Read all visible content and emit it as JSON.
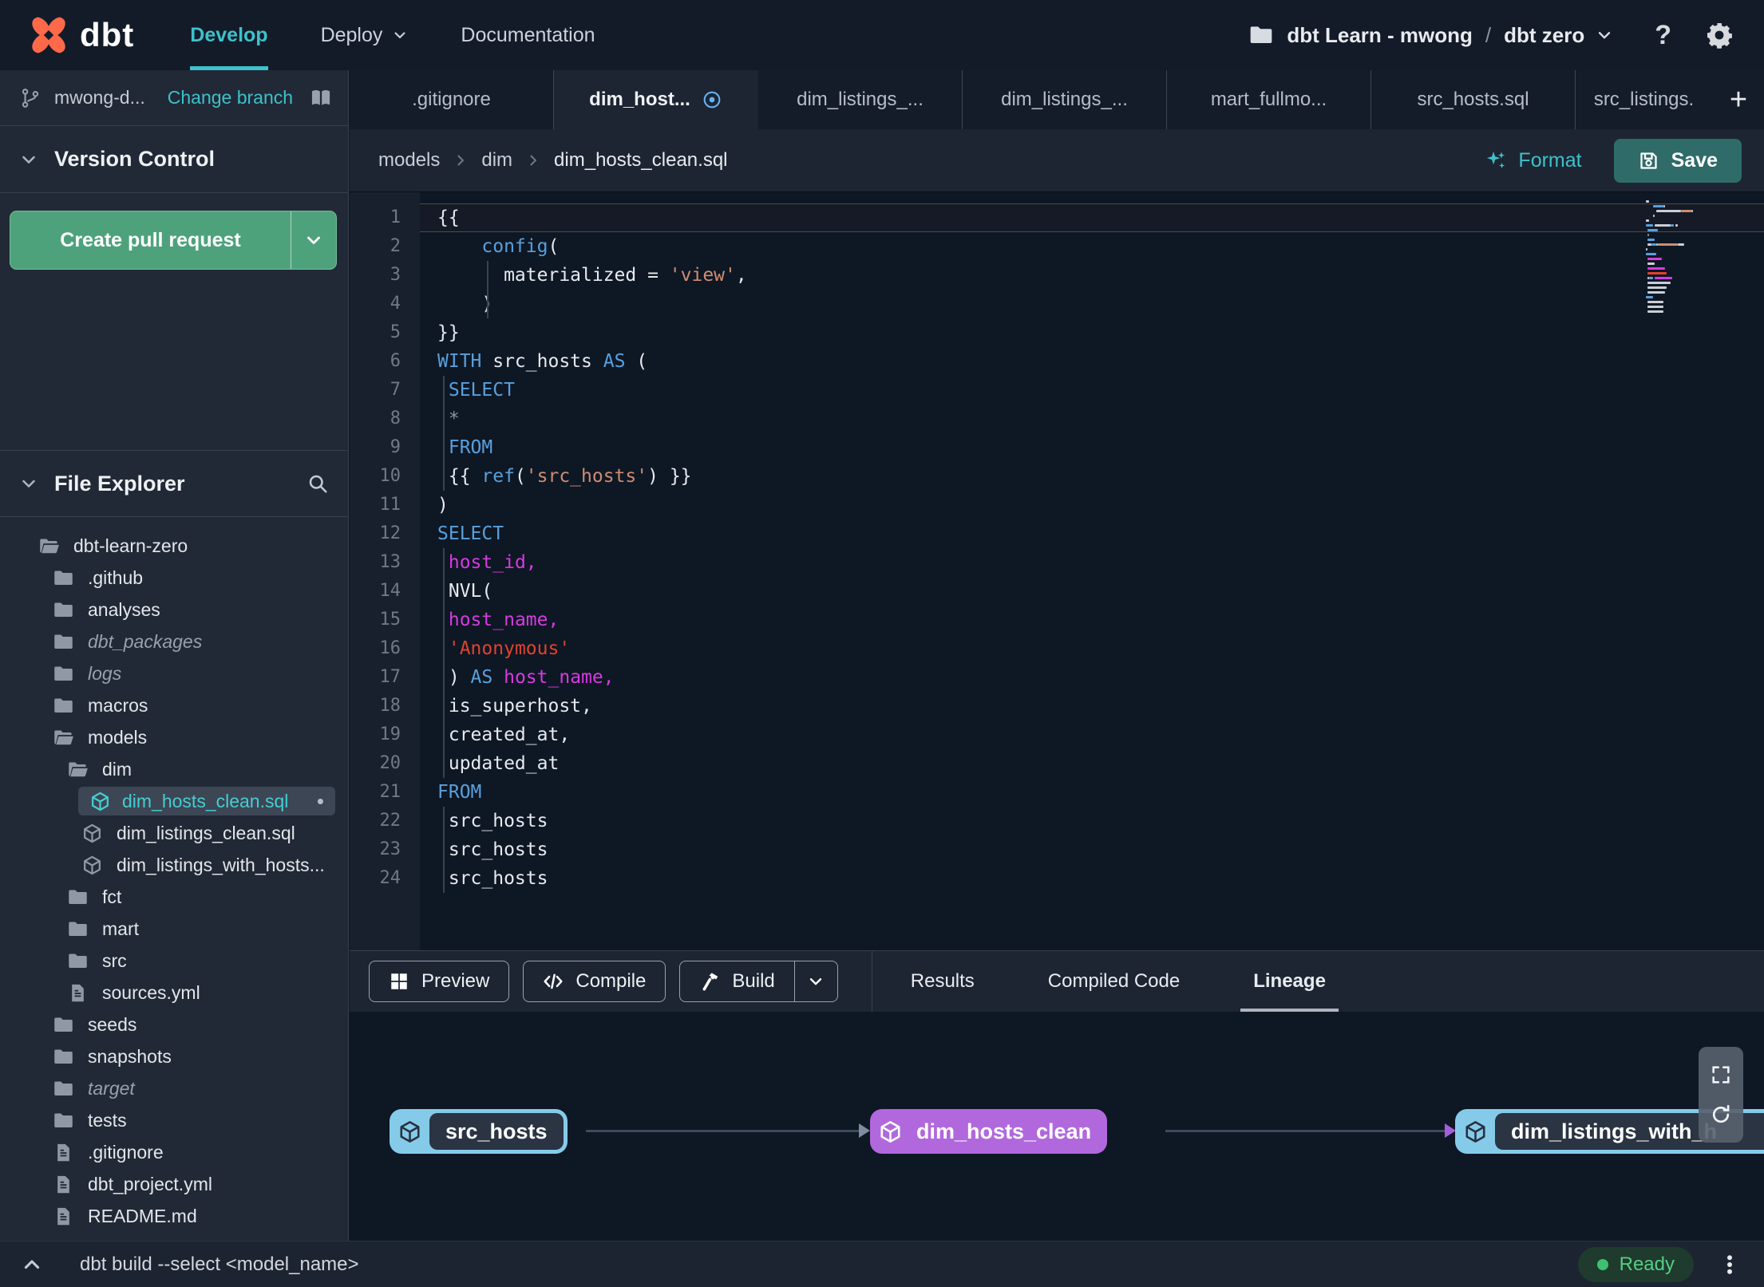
{
  "colors": {
    "accent_teal": "#3ec1ca",
    "green_button": "#4ea27b",
    "save_button_teal": "#2f6b68",
    "lineage_node_blue": "#85cbe9",
    "lineage_node_purple": "#b168dd",
    "ready_green": "#57cc86",
    "tab_modified_blue": "#66b3f5",
    "code_keyword_blue": "#58a0dc",
    "code_identifier_magenta": "#d63ae1",
    "code_string_salmon": "#cf8d72",
    "code_string_red": "#e0432d"
  },
  "topbar": {
    "brand": "dbt",
    "nav": [
      {
        "label": "Develop",
        "active": true
      },
      {
        "label": "Deploy",
        "caret": true
      },
      {
        "label": "Documentation"
      }
    ],
    "project": {
      "account": "dbt Learn - mwong",
      "separator": "/",
      "name": "dbt zero"
    }
  },
  "sidebar": {
    "branch": {
      "name": "mwong-d...",
      "action": "Change branch"
    },
    "version_control": {
      "title": "Version Control",
      "create_pr_label": "Create pull request"
    },
    "file_explorer": {
      "title": "File Explorer"
    },
    "tree": [
      {
        "label": "dbt-learn-zero",
        "type": "folder-open",
        "depth": 0
      },
      {
        "label": ".github",
        "type": "folder",
        "depth": 1
      },
      {
        "label": "analyses",
        "type": "folder",
        "depth": 1
      },
      {
        "label": "dbt_packages",
        "type": "folder",
        "depth": 1,
        "italic": true
      },
      {
        "label": "logs",
        "type": "folder",
        "depth": 1,
        "italic": true
      },
      {
        "label": "macros",
        "type": "folder",
        "depth": 1
      },
      {
        "label": "models",
        "type": "folder-open",
        "depth": 1
      },
      {
        "label": "dim",
        "type": "folder-open",
        "depth": 2
      },
      {
        "label": "dim_hosts_clean.sql",
        "type": "model",
        "depth": 3,
        "selected": true,
        "modified": true
      },
      {
        "label": "dim_listings_clean.sql",
        "type": "model",
        "depth": 3
      },
      {
        "label": "dim_listings_with_hosts...",
        "type": "model",
        "depth": 3
      },
      {
        "label": "fct",
        "type": "folder",
        "depth": 2
      },
      {
        "label": "mart",
        "type": "folder",
        "depth": 2
      },
      {
        "label": "src",
        "type": "folder",
        "depth": 2
      },
      {
        "label": "sources.yml",
        "type": "file",
        "depth": 2
      },
      {
        "label": "seeds",
        "type": "folder",
        "depth": 1
      },
      {
        "label": "snapshots",
        "type": "folder",
        "depth": 1
      },
      {
        "label": "target",
        "type": "folder",
        "depth": 1,
        "italic": true
      },
      {
        "label": "tests",
        "type": "folder",
        "depth": 1
      },
      {
        "label": ".gitignore",
        "type": "file",
        "depth": 1
      },
      {
        "label": "dbt_project.yml",
        "type": "file",
        "depth": 1
      },
      {
        "label": "README.md",
        "type": "file",
        "depth": 1
      }
    ]
  },
  "tabs": [
    {
      "label": ".gitignore"
    },
    {
      "label": "dim_host...",
      "active": true,
      "modified": true
    },
    {
      "label": "dim_listings_..."
    },
    {
      "label": "dim_listings_..."
    },
    {
      "label": "mart_fullmo..."
    },
    {
      "label": "src_hosts.sql"
    },
    {
      "label": "src_listings.",
      "clipped": true
    }
  ],
  "breadcrumb": [
    "models",
    "dim",
    "dim_hosts_clean.sql"
  ],
  "editor_actions": {
    "format": "Format",
    "save": "Save"
  },
  "editor": {
    "current_line": 1,
    "lines": [
      {
        "n": 1,
        "tokens": [
          [
            "d",
            "{{"
          ]
        ]
      },
      {
        "n": 2,
        "tokens": [
          [
            "d",
            "    "
          ],
          [
            "k",
            "config"
          ],
          [
            "d",
            "("
          ]
        ]
      },
      {
        "n": 3,
        "tokens": [
          [
            "d",
            "      materialized = "
          ],
          [
            "s",
            "'view'"
          ],
          [
            "d",
            ","
          ]
        ]
      },
      {
        "n": 4,
        "tokens": [
          [
            "d",
            "    )"
          ]
        ]
      },
      {
        "n": 5,
        "tokens": [
          [
            "d",
            "}}"
          ]
        ]
      },
      {
        "n": 6,
        "tokens": [
          [
            "k",
            "WITH"
          ],
          [
            "d",
            " src_hosts "
          ],
          [
            "k",
            "AS"
          ],
          [
            "d",
            " ("
          ]
        ]
      },
      {
        "n": 7,
        "tokens": [
          [
            "d",
            " "
          ],
          [
            "k",
            "SELECT"
          ]
        ]
      },
      {
        "n": 8,
        "tokens": [
          [
            "d",
            " "
          ],
          [
            "g",
            "*"
          ]
        ]
      },
      {
        "n": 9,
        "tokens": [
          [
            "d",
            " "
          ],
          [
            "k",
            "FROM"
          ]
        ]
      },
      {
        "n": 10,
        "tokens": [
          [
            "d",
            " {{ "
          ],
          [
            "k",
            "ref"
          ],
          [
            "d",
            "("
          ],
          [
            "s",
            "'src_hosts'"
          ],
          [
            "d",
            ") }}"
          ]
        ]
      },
      {
        "n": 11,
        "tokens": [
          [
            "d",
            ")"
          ]
        ]
      },
      {
        "n": 12,
        "tokens": [
          [
            "k",
            "SELECT"
          ]
        ]
      },
      {
        "n": 13,
        "tokens": [
          [
            "d",
            " "
          ],
          [
            "m",
            "host_id,"
          ]
        ]
      },
      {
        "n": 14,
        "tokens": [
          [
            "d",
            " NVL("
          ]
        ]
      },
      {
        "n": 15,
        "tokens": [
          [
            "d",
            " "
          ],
          [
            "m",
            "host_name,"
          ]
        ]
      },
      {
        "n": 16,
        "tokens": [
          [
            "d",
            " "
          ],
          [
            "r",
            "'Anonymous'"
          ]
        ]
      },
      {
        "n": 17,
        "tokens": [
          [
            "d",
            " ) "
          ],
          [
            "k",
            "AS"
          ],
          [
            "d",
            " "
          ],
          [
            "m",
            "host_name,"
          ]
        ]
      },
      {
        "n": 18,
        "tokens": [
          [
            "d",
            " is_superhost,"
          ]
        ]
      },
      {
        "n": 19,
        "tokens": [
          [
            "d",
            " created_at,"
          ]
        ]
      },
      {
        "n": 20,
        "tokens": [
          [
            "d",
            " updated_at"
          ]
        ]
      },
      {
        "n": 21,
        "tokens": [
          [
            "k",
            "FROM"
          ]
        ]
      },
      {
        "n": 22,
        "tokens": [
          [
            "d",
            " src_hosts"
          ]
        ]
      },
      {
        "n": 23,
        "tokens": [
          [
            "d",
            " src_hosts"
          ]
        ]
      },
      {
        "n": 24,
        "tokens": [
          [
            "d",
            " src_hosts"
          ]
        ]
      }
    ]
  },
  "panel": {
    "buttons": [
      {
        "label": "Preview",
        "icon": "grid"
      },
      {
        "label": "Compile",
        "icon": "code"
      },
      {
        "label": "Build",
        "icon": "hammer",
        "split": true
      }
    ],
    "tabs": [
      {
        "label": "Results"
      },
      {
        "label": "Compiled Code"
      },
      {
        "label": "Lineage",
        "active": true
      }
    ]
  },
  "lineage": {
    "nodes": [
      {
        "label": "src_hosts",
        "color": "blue"
      },
      {
        "label": "dim_hosts_clean",
        "color": "purple"
      },
      {
        "label": "dim_listings_with_h",
        "color": "blue"
      }
    ]
  },
  "status_bar": {
    "command": "dbt build --select <model_name>",
    "status": "Ready"
  }
}
